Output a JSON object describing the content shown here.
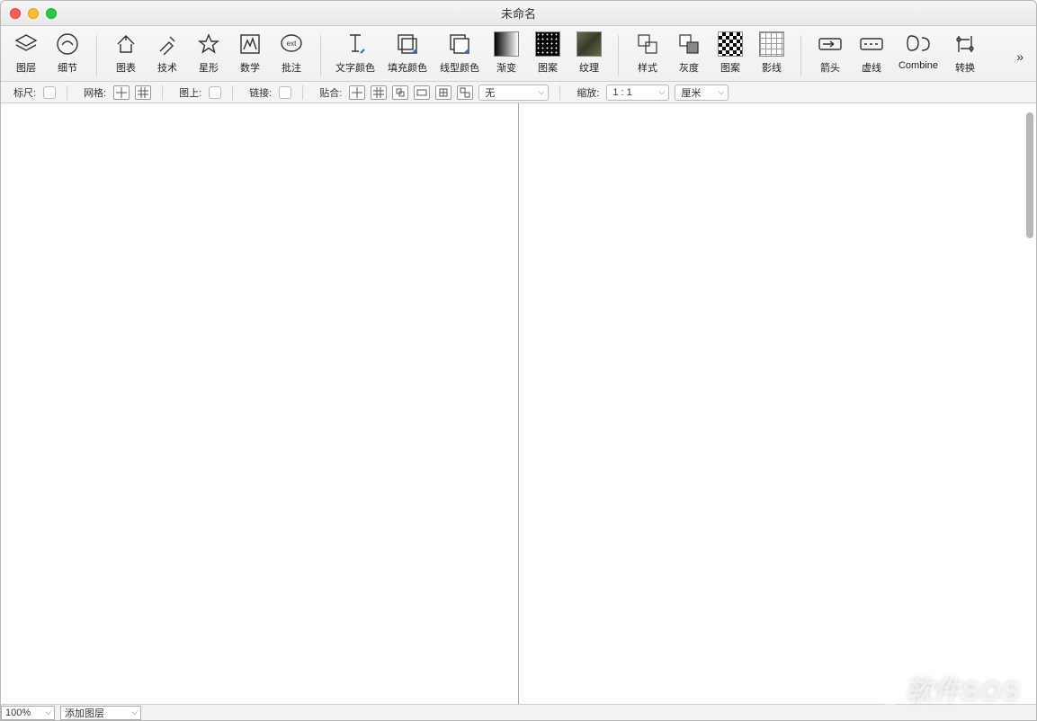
{
  "window": {
    "title": "未命名"
  },
  "toolbar": {
    "groups": [
      [
        {
          "name": "layers",
          "label": "图层"
        },
        {
          "name": "details",
          "label": "细节"
        }
      ],
      [
        {
          "name": "chart",
          "label": "图表"
        },
        {
          "name": "technique",
          "label": "技术"
        },
        {
          "name": "star",
          "label": "星形"
        },
        {
          "name": "math",
          "label": "数学"
        },
        {
          "name": "annotate",
          "label": "批注"
        }
      ],
      [
        {
          "name": "text-color",
          "label": "文字颜色"
        },
        {
          "name": "fill-color",
          "label": "填充颜色"
        },
        {
          "name": "line-color",
          "label": "线型颜色"
        },
        {
          "name": "gradient",
          "label": "渐变"
        },
        {
          "name": "pattern",
          "label": "图案"
        },
        {
          "name": "texture",
          "label": "纹理"
        }
      ],
      [
        {
          "name": "style",
          "label": "样式"
        },
        {
          "name": "gray",
          "label": "灰度"
        },
        {
          "name": "pattern2",
          "label": "图案"
        },
        {
          "name": "hatch",
          "label": "影线"
        }
      ],
      [
        {
          "name": "arrow",
          "label": "箭头"
        },
        {
          "name": "dash",
          "label": "虚线"
        },
        {
          "name": "combine",
          "label": "Combine"
        },
        {
          "name": "convert",
          "label": "转换"
        }
      ]
    ]
  },
  "options": {
    "ruler_label": "标尺:",
    "grid_label": "网格:",
    "onimage_label": "图上:",
    "link_label": "链接:",
    "snap_label": "贴合:",
    "snap_none": "无",
    "zoom_label": "缩放:",
    "zoom_value": "1 : 1",
    "unit_value": "厘米"
  },
  "status": {
    "zoom": "100%",
    "add_layer": "添加图层"
  },
  "watermark": "软件SOS"
}
